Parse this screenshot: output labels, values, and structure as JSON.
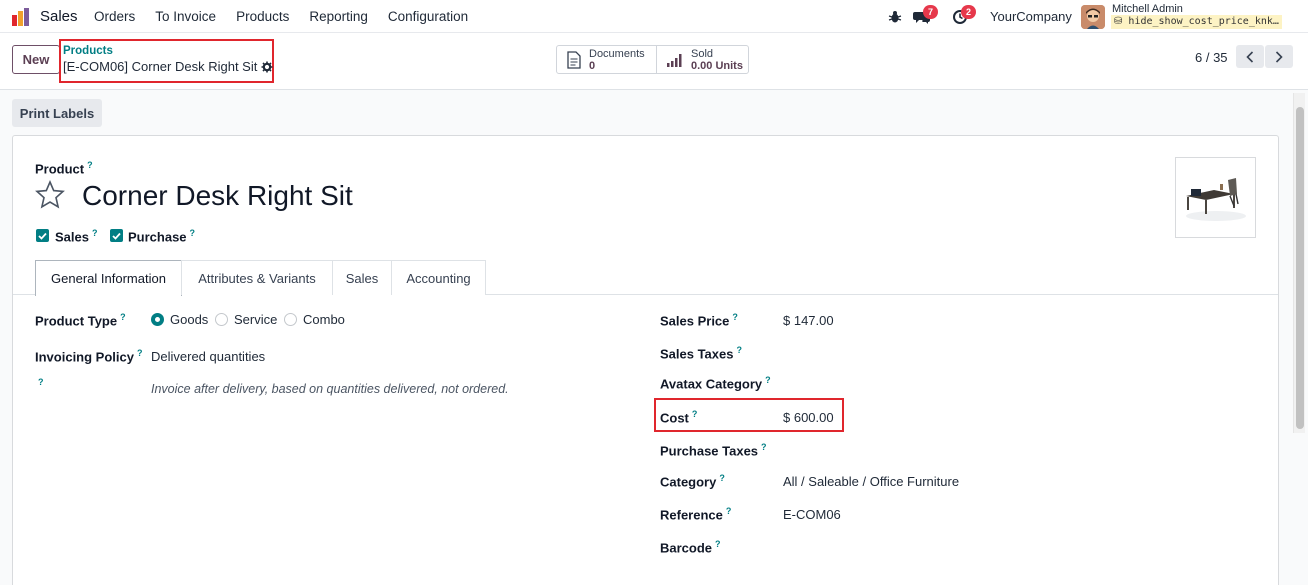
{
  "navbar": {
    "app_name": "Sales",
    "menu": [
      "Orders",
      "To Invoice",
      "Products",
      "Reporting",
      "Configuration"
    ],
    "chat_badge": "7",
    "activity_badge": "2",
    "company": "YourCompany",
    "user_name": "Mitchell Admin",
    "database": "hide_show_cost_price_knk…"
  },
  "control": {
    "new_label": "New",
    "breadcrumb_parent": "Products",
    "breadcrumb_current": "[E-COM06] Corner Desk Right Sit",
    "smart_buttons": [
      {
        "label": "Documents",
        "value": "0"
      },
      {
        "label": "Sold",
        "value": "0.00 Units"
      }
    ],
    "pager": "6 / 35"
  },
  "form": {
    "print_labels": "Print Labels",
    "product_label": "Product",
    "product_name": "Corner Desk Right Sit",
    "sales_checkbox": "Sales",
    "purchase_checkbox": "Purchase",
    "tabs": [
      "General Information",
      "Attributes & Variants",
      "Sales",
      "Accounting"
    ],
    "product_type_label": "Product Type",
    "product_type_options": [
      "Goods",
      "Service",
      "Combo"
    ],
    "product_type_selected": "Goods",
    "invoicing_policy_label": "Invoicing Policy",
    "invoicing_policy_value": "Delivered quantities",
    "invoicing_hint": "Invoice after delivery, based on quantities delivered, not ordered.",
    "sales_price_label": "Sales Price",
    "sales_price_value": "$ 147.00",
    "sales_taxes_label": "Sales Taxes",
    "avatax_label": "Avatax Category",
    "cost_label": "Cost",
    "cost_value": "$ 600.00",
    "purchase_taxes_label": "Purchase Taxes",
    "category_label": "Category",
    "category_value": "All / Saleable / Office Furniture",
    "reference_label": "Reference",
    "reference_value": "E-COM06",
    "barcode_label": "Barcode",
    "help_mark": "?"
  },
  "colors": {
    "brand": "#5b3f53",
    "accent": "#017e84",
    "highlight": "#e0262d",
    "badge": "#e6384b"
  }
}
